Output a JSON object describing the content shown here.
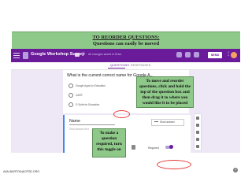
{
  "banner": {
    "line1": "TO REORDER QUESTIONS:",
    "line2": "Questions can easily be moved"
  },
  "appbar": {
    "title": "Google Workshop Survey",
    "saved_text": "All changes saved in Drive",
    "send_label": "SEND",
    "avatar_letter": "A",
    "accent_color": "#6a1b9a"
  },
  "tabs": [
    {
      "label": "QUESTIONS",
      "active": true
    },
    {
      "label": "RESPONSES",
      "active": false
    }
  ],
  "question_card": {
    "question": "What is the current correct name for Google A...",
    "options": [
      "Google Apps for Education",
      "GAFE",
      "G Suite for Education"
    ]
  },
  "name_card": {
    "title": "Name",
    "placeholder": "Short answer text",
    "type_label": "Short answer",
    "required_label": "Required"
  },
  "callouts": {
    "reorder": "To move and reorder questions, click and hold the top of the question box and then drag it to where you would like it to be placed",
    "required": "To make a question required, turn this toggle on"
  },
  "footer": {
    "text": "AVALBARTOK@CPSD.ORG"
  },
  "help_icon": "?"
}
